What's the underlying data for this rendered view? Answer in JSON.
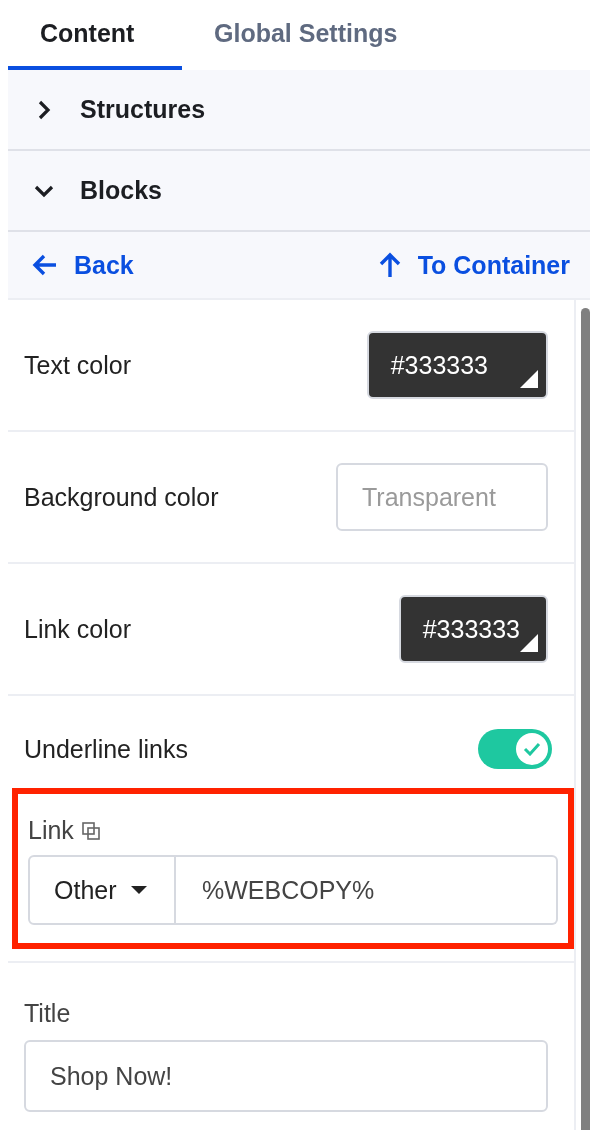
{
  "tabs": [
    {
      "label": "Content",
      "selected": true
    },
    {
      "label": "Global Settings",
      "selected": false
    }
  ],
  "sections": [
    {
      "label": "Structures",
      "expanded": false
    },
    {
      "label": "Blocks",
      "expanded": true
    }
  ],
  "nav": {
    "back": "Back",
    "up": "To Container"
  },
  "settings": [
    {
      "kind": "color",
      "label": "Text color",
      "value": "#333333"
    },
    {
      "kind": "color",
      "label": "Background color",
      "placeholder": "Transparent"
    },
    {
      "kind": "color",
      "label": "Link color",
      "value": "#333333"
    },
    {
      "kind": "toggle",
      "label": "Underline links",
      "on": true
    }
  ],
  "link": {
    "label": "Link",
    "type": "Other",
    "value": "%WEBCOPY%",
    "highlighted": true
  },
  "title": {
    "label": "Title",
    "value": "Shop Now!"
  }
}
